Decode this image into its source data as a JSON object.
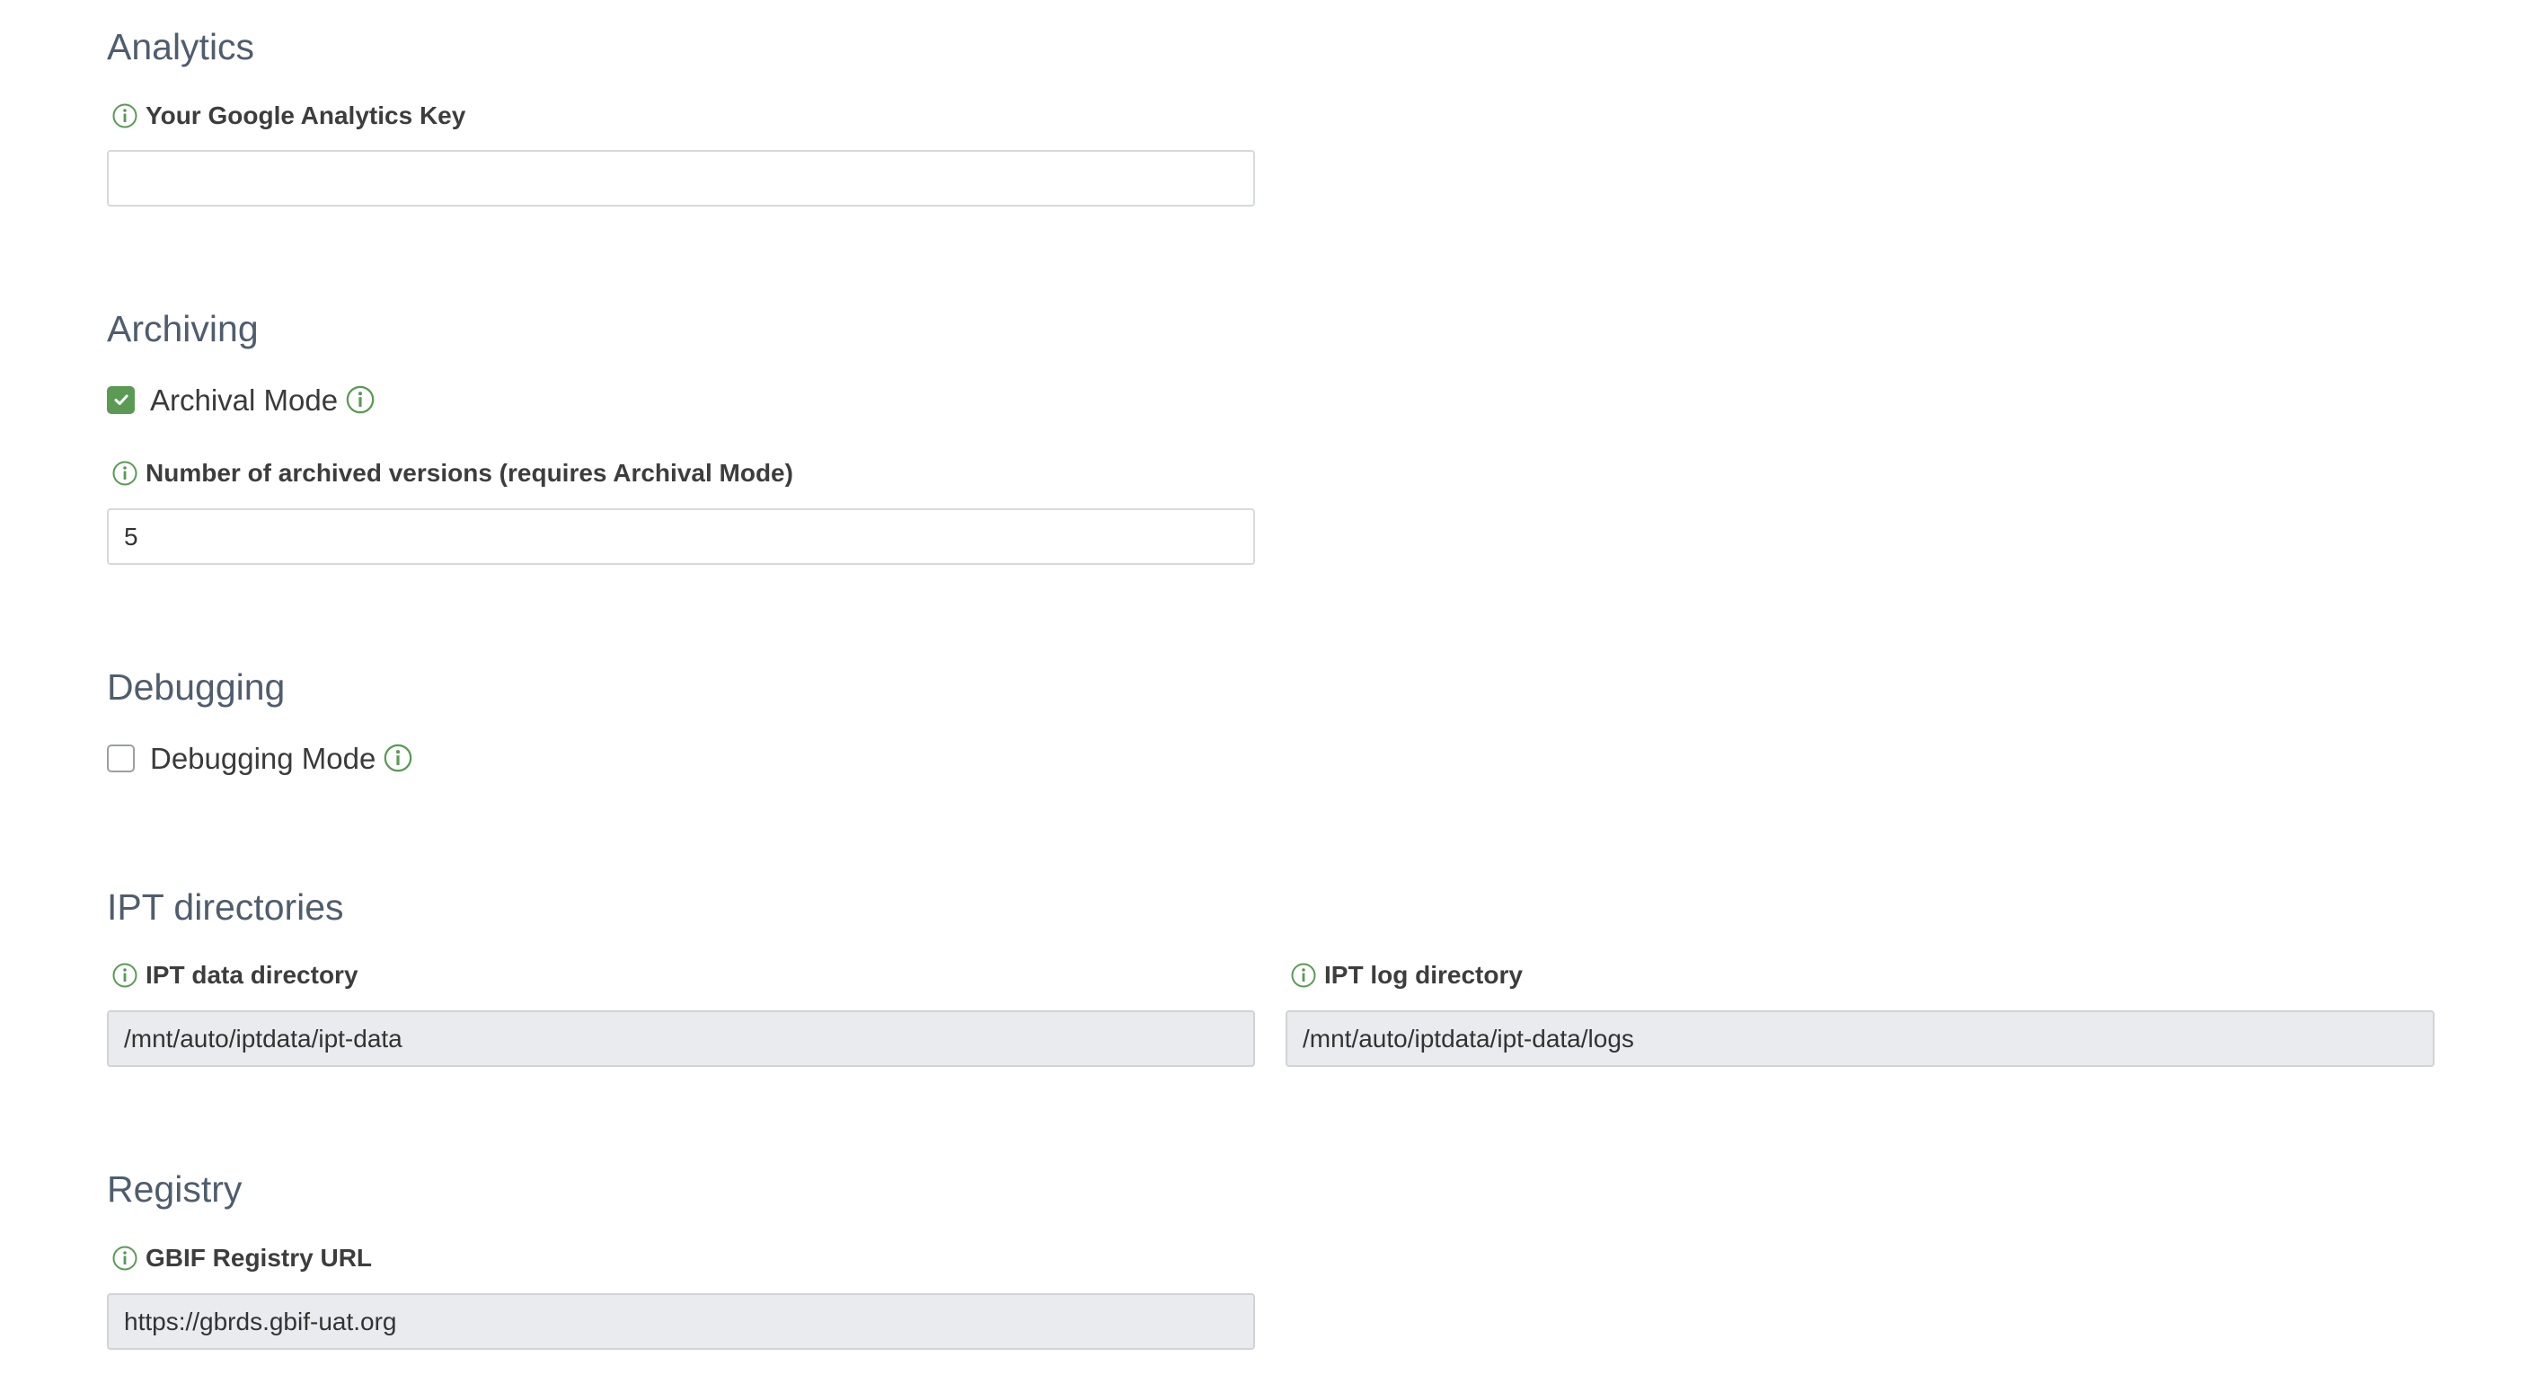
{
  "colors": {
    "accent_green": "#5a9a55",
    "section_title": "#4f5d6e",
    "readonly_bg": "#e9ebee"
  },
  "analytics": {
    "title": "Analytics",
    "key_label": "Your Google Analytics Key",
    "key_value": ""
  },
  "archiving": {
    "title": "Archiving",
    "archival_mode_label": "Archival Mode",
    "archival_mode_checked": true,
    "versions_label": "Number of archived versions (requires Archival Mode)",
    "versions_value": "5"
  },
  "debugging": {
    "title": "Debugging",
    "debug_mode_label": "Debugging Mode",
    "debug_mode_checked": false
  },
  "directories": {
    "title": "IPT directories",
    "data_dir_label": "IPT data directory",
    "data_dir_value": "/mnt/auto/iptdata/ipt-data",
    "log_dir_label": "IPT log directory",
    "log_dir_value": "/mnt/auto/iptdata/ipt-data/logs"
  },
  "registry": {
    "title": "Registry",
    "url_label": "GBIF Registry URL",
    "url_value": "https://gbrds.gbif-uat.org"
  },
  "icons": {
    "info": "info-circle-icon",
    "check": "checkmark-icon"
  }
}
